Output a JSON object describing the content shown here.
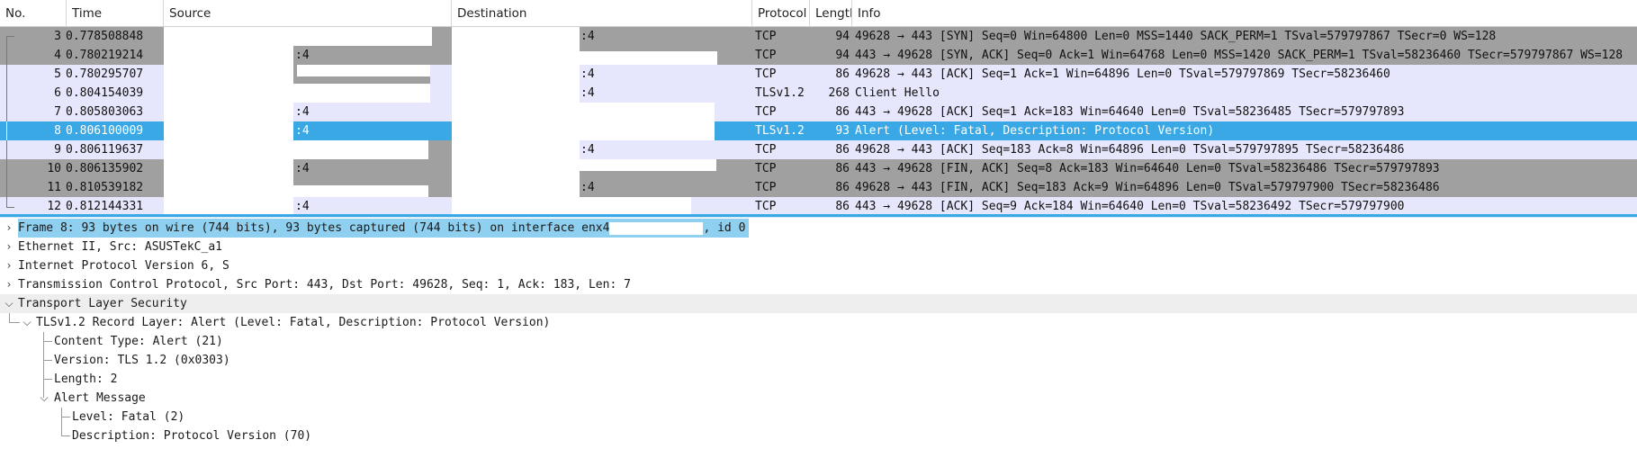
{
  "columns": {
    "no": "No.",
    "time": "Time",
    "source": "Source",
    "destination": "Destination",
    "protocol": "Protocol",
    "length": "Lengtl",
    "info": "Info"
  },
  "packets": [
    {
      "no": "3",
      "time": "0.778508848",
      "src_port": "",
      "dst_port": ":4",
      "protocol": "TCP",
      "length": "94",
      "info": "49628 → 443 [SYN] Seq=0 Win=64800 Len=0 MSS=1440 SACK_PERM=1 TSval=579797867 TSecr=0 WS=128"
    },
    {
      "no": "4",
      "time": "0.780219214",
      "src_port": ":4",
      "dst_port": "",
      "protocol": "TCP",
      "length": "94",
      "info": "443 → 49628 [SYN, ACK] Seq=0 Ack=1 Win=64768 Len=0 MSS=1420 SACK_PERM=1 TSval=58236460 TSecr=579797867 WS=128"
    },
    {
      "no": "5",
      "time": "0.780295707",
      "src_port": "",
      "dst_port": ":4",
      "protocol": "TCP",
      "length": "86",
      "info": "49628 → 443 [ACK] Seq=1 Ack=1 Win=64896 Len=0 TSval=579797869 TSecr=58236460"
    },
    {
      "no": "6",
      "time": "0.804154039",
      "src_port": "",
      "dst_port": ":4",
      "protocol": "TLSv1.2",
      "length": "268",
      "info": "Client Hello"
    },
    {
      "no": "7",
      "time": "0.805803063",
      "src_port": ":4",
      "dst_port": "",
      "protocol": "TCP",
      "length": "86",
      "info": "443 → 49628 [ACK] Seq=1 Ack=183 Win=64640 Len=0 TSval=58236485 TSecr=579797893"
    },
    {
      "no": "8",
      "time": "0.806100009",
      "src_port": ":4",
      "dst_port": "",
      "protocol": "TLSv1.2",
      "length": "93",
      "info": "Alert (Level: Fatal, Description: Protocol Version)"
    },
    {
      "no": "9",
      "time": "0.806119637",
      "src_port": "",
      "dst_port": ":4",
      "protocol": "TCP",
      "length": "86",
      "info": "49628 → 443 [ACK] Seq=183 Ack=8 Win=64896 Len=0 TSval=579797895 TSecr=58236486"
    },
    {
      "no": "10",
      "time": "0.806135902",
      "src_port": ":4",
      "dst_port": "",
      "protocol": "TCP",
      "length": "86",
      "info": "443 → 49628 [FIN, ACK] Seq=8 Ack=183 Win=64640 Len=0 TSval=58236486 TSecr=579797893"
    },
    {
      "no": "11",
      "time": "0.810539182",
      "src_port": "",
      "dst_port": ":4",
      "protocol": "TCP",
      "length": "86",
      "info": "49628 → 443 [FIN, ACK] Seq=183 Ack=9 Win=64896 Len=0 TSval=579797900 TSecr=58236486"
    },
    {
      "no": "12",
      "time": "0.812144331",
      "src_port": ":4",
      "dst_port": "",
      "protocol": "TCP",
      "length": "86",
      "info": "443 → 49628 [ACK] Seq=9 Ack=184 Win=64640 Len=0 TSval=58236492 TSecr=579797900"
    }
  ],
  "details": [
    {
      "text": "Frame 8: 93 bytes on wire (744 bits), 93 bytes captured (744 bits) on interface enx4",
      "suffix": ", id 0",
      "expanded": false
    },
    {
      "text": "Ethernet II, Src: ASUSTekC_a1",
      "expanded": false
    },
    {
      "text": "Internet Protocol Version 6, S",
      "expanded": false
    },
    {
      "text": "Transmission Control Protocol, Src Port: 443, Dst Port: 49628, Seq: 1, Ack: 183, Len: 7",
      "expanded": false
    },
    {
      "text": "Transport Layer Security",
      "expanded": true
    },
    {
      "text": "TLSv1.2 Record Layer: Alert (Level: Fatal, Description: Protocol Version)",
      "expanded": true
    },
    {
      "text": "Content Type: Alert (21)"
    },
    {
      "text": "Version: TLS 1.2 (0x0303)"
    },
    {
      "text": "Length: 2"
    },
    {
      "text": "Alert Message",
      "expanded": true
    },
    {
      "text": "Level: Fatal (2)"
    },
    {
      "text": "Description: Protocol Version (70)"
    }
  ],
  "colors": {
    "row_gray": "#a0a0a0",
    "row_lavender": "#e6e6fc",
    "row_selected": "#3aa8e4",
    "detail_selected": "#8fcfef"
  },
  "icons": {
    "collapsed": "chevron-right-icon",
    "expanded": "chevron-down-icon"
  }
}
